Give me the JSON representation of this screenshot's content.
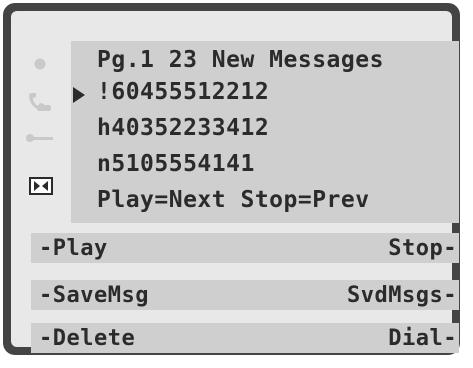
{
  "screen": {
    "header": "Pg.1 23 New Messages",
    "messages": [
      "!60455512212",
      "h40352233412",
      "n5105554141"
    ],
    "footer": "Play=Next Stop=Prev",
    "selected_index": 0
  },
  "side_icons": [
    "message-light-icon",
    "handset-icon",
    "key-icon",
    "play-pause-icon"
  ],
  "softkeys": [
    {
      "left": "-Play",
      "right": "Stop-"
    },
    {
      "left": "-SaveMsg",
      "right": "SvdMsgs-"
    },
    {
      "left": "-Delete",
      "right": "Dial-"
    }
  ]
}
